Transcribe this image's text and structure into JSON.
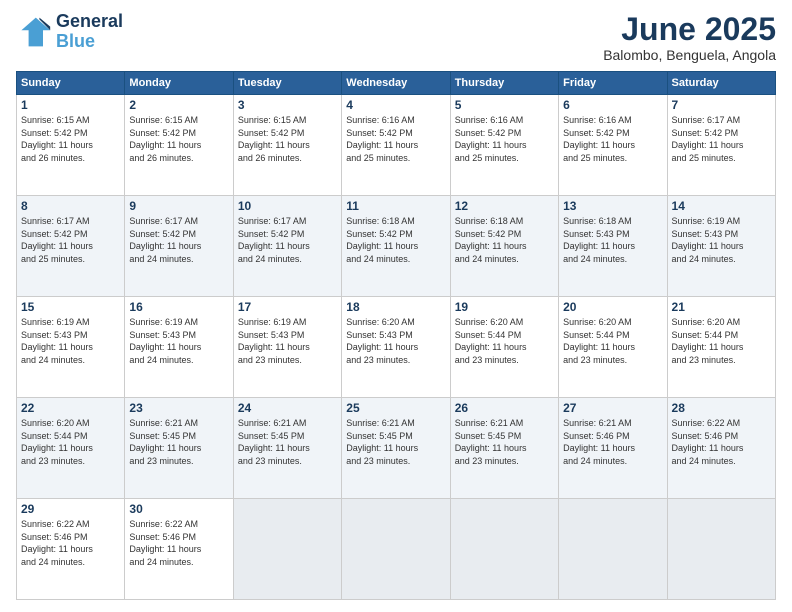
{
  "logo": {
    "line1": "General",
    "line2": "Blue"
  },
  "title": "June 2025",
  "subtitle": "Balombo, Benguela, Angola",
  "days_header": [
    "Sunday",
    "Monday",
    "Tuesday",
    "Wednesday",
    "Thursday",
    "Friday",
    "Saturday"
  ],
  "weeks": [
    [
      {
        "day": "1",
        "info": "Sunrise: 6:15 AM\nSunset: 5:42 PM\nDaylight: 11 hours\nand 26 minutes."
      },
      {
        "day": "2",
        "info": "Sunrise: 6:15 AM\nSunset: 5:42 PM\nDaylight: 11 hours\nand 26 minutes."
      },
      {
        "day": "3",
        "info": "Sunrise: 6:15 AM\nSunset: 5:42 PM\nDaylight: 11 hours\nand 26 minutes."
      },
      {
        "day": "4",
        "info": "Sunrise: 6:16 AM\nSunset: 5:42 PM\nDaylight: 11 hours\nand 25 minutes."
      },
      {
        "day": "5",
        "info": "Sunrise: 6:16 AM\nSunset: 5:42 PM\nDaylight: 11 hours\nand 25 minutes."
      },
      {
        "day": "6",
        "info": "Sunrise: 6:16 AM\nSunset: 5:42 PM\nDaylight: 11 hours\nand 25 minutes."
      },
      {
        "day": "7",
        "info": "Sunrise: 6:17 AM\nSunset: 5:42 PM\nDaylight: 11 hours\nand 25 minutes."
      }
    ],
    [
      {
        "day": "8",
        "info": "Sunrise: 6:17 AM\nSunset: 5:42 PM\nDaylight: 11 hours\nand 25 minutes."
      },
      {
        "day": "9",
        "info": "Sunrise: 6:17 AM\nSunset: 5:42 PM\nDaylight: 11 hours\nand 24 minutes."
      },
      {
        "day": "10",
        "info": "Sunrise: 6:17 AM\nSunset: 5:42 PM\nDaylight: 11 hours\nand 24 minutes."
      },
      {
        "day": "11",
        "info": "Sunrise: 6:18 AM\nSunset: 5:42 PM\nDaylight: 11 hours\nand 24 minutes."
      },
      {
        "day": "12",
        "info": "Sunrise: 6:18 AM\nSunset: 5:42 PM\nDaylight: 11 hours\nand 24 minutes."
      },
      {
        "day": "13",
        "info": "Sunrise: 6:18 AM\nSunset: 5:43 PM\nDaylight: 11 hours\nand 24 minutes."
      },
      {
        "day": "14",
        "info": "Sunrise: 6:19 AM\nSunset: 5:43 PM\nDaylight: 11 hours\nand 24 minutes."
      }
    ],
    [
      {
        "day": "15",
        "info": "Sunrise: 6:19 AM\nSunset: 5:43 PM\nDaylight: 11 hours\nand 24 minutes."
      },
      {
        "day": "16",
        "info": "Sunrise: 6:19 AM\nSunset: 5:43 PM\nDaylight: 11 hours\nand 24 minutes."
      },
      {
        "day": "17",
        "info": "Sunrise: 6:19 AM\nSunset: 5:43 PM\nDaylight: 11 hours\nand 23 minutes."
      },
      {
        "day": "18",
        "info": "Sunrise: 6:20 AM\nSunset: 5:43 PM\nDaylight: 11 hours\nand 23 minutes."
      },
      {
        "day": "19",
        "info": "Sunrise: 6:20 AM\nSunset: 5:44 PM\nDaylight: 11 hours\nand 23 minutes."
      },
      {
        "day": "20",
        "info": "Sunrise: 6:20 AM\nSunset: 5:44 PM\nDaylight: 11 hours\nand 23 minutes."
      },
      {
        "day": "21",
        "info": "Sunrise: 6:20 AM\nSunset: 5:44 PM\nDaylight: 11 hours\nand 23 minutes."
      }
    ],
    [
      {
        "day": "22",
        "info": "Sunrise: 6:20 AM\nSunset: 5:44 PM\nDaylight: 11 hours\nand 23 minutes."
      },
      {
        "day": "23",
        "info": "Sunrise: 6:21 AM\nSunset: 5:45 PM\nDaylight: 11 hours\nand 23 minutes."
      },
      {
        "day": "24",
        "info": "Sunrise: 6:21 AM\nSunset: 5:45 PM\nDaylight: 11 hours\nand 23 minutes."
      },
      {
        "day": "25",
        "info": "Sunrise: 6:21 AM\nSunset: 5:45 PM\nDaylight: 11 hours\nand 23 minutes."
      },
      {
        "day": "26",
        "info": "Sunrise: 6:21 AM\nSunset: 5:45 PM\nDaylight: 11 hours\nand 23 minutes."
      },
      {
        "day": "27",
        "info": "Sunrise: 6:21 AM\nSunset: 5:46 PM\nDaylight: 11 hours\nand 24 minutes."
      },
      {
        "day": "28",
        "info": "Sunrise: 6:22 AM\nSunset: 5:46 PM\nDaylight: 11 hours\nand 24 minutes."
      }
    ],
    [
      {
        "day": "29",
        "info": "Sunrise: 6:22 AM\nSunset: 5:46 PM\nDaylight: 11 hours\nand 24 minutes."
      },
      {
        "day": "30",
        "info": "Sunrise: 6:22 AM\nSunset: 5:46 PM\nDaylight: 11 hours\nand 24 minutes."
      },
      {
        "day": "",
        "info": ""
      },
      {
        "day": "",
        "info": ""
      },
      {
        "day": "",
        "info": ""
      },
      {
        "day": "",
        "info": ""
      },
      {
        "day": "",
        "info": ""
      }
    ]
  ]
}
